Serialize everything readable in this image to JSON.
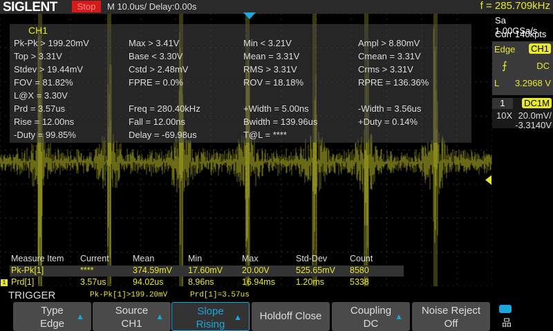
{
  "header": {
    "logo": "SIGLENT",
    "run_state": "Stop",
    "timebase": "M 10.0us/  Delay:0.00s",
    "frequency": "f = 285.709kHz"
  },
  "acq": {
    "sample_rate": "Sa 1.00GSa/s",
    "memory": "Curr 140kpts"
  },
  "trigger_panel": {
    "type": "Edge",
    "source": "CH1",
    "coupling": "DC",
    "level_label": "L",
    "level": "3.2968 V"
  },
  "channel_panel": {
    "number": "1",
    "coupling": "DC1M",
    "probe": "10X",
    "scale": "20.0mV/",
    "offset": "-3.3140V"
  },
  "measurements": {
    "channel": "CH1",
    "rows": [
      [
        "Pk-Pk > 199.20mV",
        "Max > 3.41V",
        "Min < 3.21V",
        "Ampl > 8.80mV"
      ],
      [
        "Top > 3.31V",
        "Base < 3.30V",
        "Mean = 3.31V",
        "Cmean = 3.31V"
      ],
      [
        "Stdev > 19.44mV",
        "Cstd > 2.48mV",
        "RMS > 3.31V",
        "Crms > 3.31V"
      ],
      [
        "FOV = 81.82%",
        "FPRE = 0.0%",
        "ROV = 18.18%",
        "RPRE = 136.36%"
      ],
      [
        "L@X = 3.30V",
        "",
        "",
        ""
      ],
      [
        "Prd = 3.57us",
        "Freq = 280.40kHz",
        "+Width = 5.00ns",
        "-Width = 3.56us"
      ],
      [
        "Rise = 12.00ns",
        "Fall = 12.00ns",
        "Bwidth = 139.96us",
        "+Duty = 0.14%"
      ],
      [
        "-Duty = 99.85%",
        "Delay = -69.98us",
        "T@L = ****",
        ""
      ]
    ]
  },
  "stats": {
    "headers": [
      "Measure Item",
      "Current",
      "Mean",
      "Min",
      "Max",
      "Std-Dev",
      "Count"
    ],
    "rows": [
      [
        "Pk-Pk[1]",
        "****",
        "374.59mV",
        "17.60mV",
        "20.00V",
        "525.65mV",
        "8580"
      ],
      [
        "Prd[1]",
        "3.57us",
        "94.02us",
        "8.96ns",
        "16.94ms",
        "1.20ms",
        "5338"
      ]
    ]
  },
  "trigger_bar": {
    "title": "TRIGGER",
    "pkpk": "Pk-Pk[1]>199.20mV",
    "prd": "Prd[1]=3.57us"
  },
  "softkeys": [
    {
      "l1": "Type",
      "l2": "Edge"
    },
    {
      "l1": "Source",
      "l2": "CH1"
    },
    {
      "l1": "Slope",
      "l2": "Rising"
    },
    {
      "l1": "Holdoff Close",
      "l2": ""
    },
    {
      "l1": "Coupling",
      "l2": "DC"
    },
    {
      "l1": "Noise Reject",
      "l2": "Off"
    }
  ],
  "colors": {
    "trace": "#e8e830",
    "accent": "#1da6dc",
    "stop": "#d41a1a"
  }
}
